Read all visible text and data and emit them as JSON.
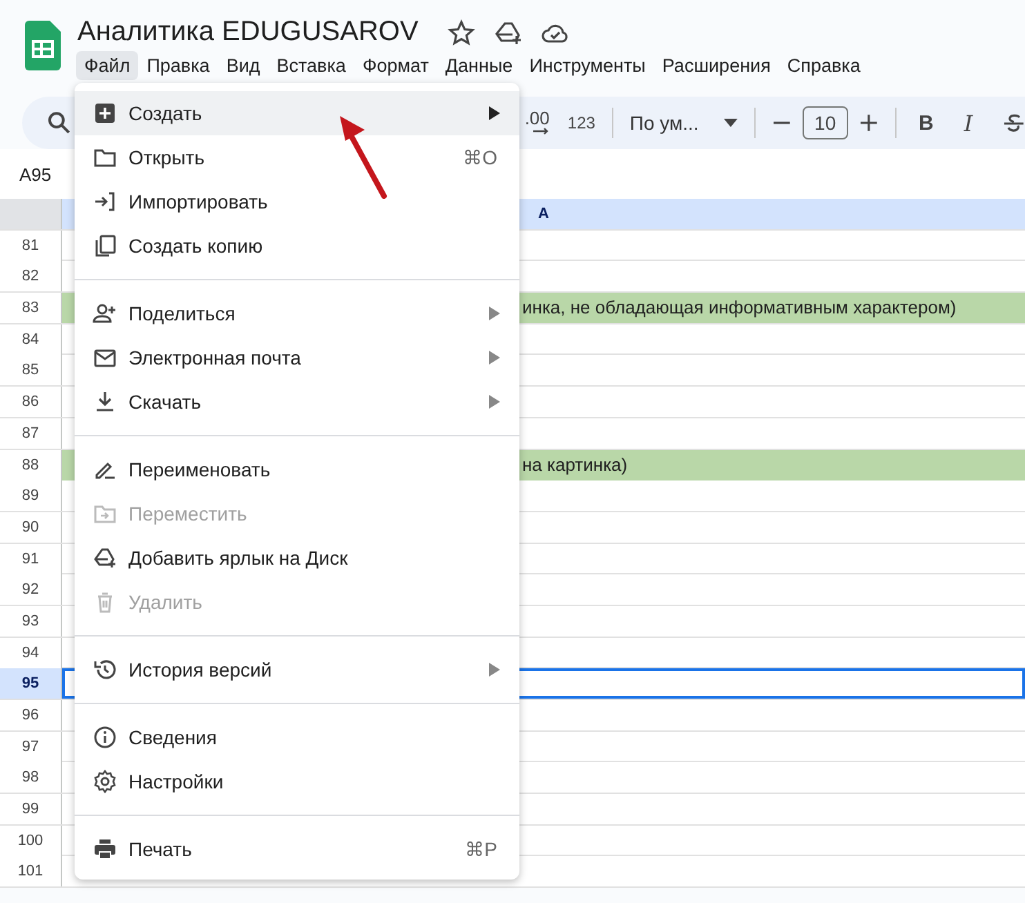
{
  "app": {
    "title": "Аналитика EDUGUSAROV",
    "menu": [
      {
        "label": "Файл",
        "selected": true
      },
      {
        "label": "Правка",
        "selected": false
      },
      {
        "label": "Вид",
        "selected": false
      },
      {
        "label": "Вставка",
        "selected": false
      },
      {
        "label": "Формат",
        "selected": false
      },
      {
        "label": "Данные",
        "selected": false
      },
      {
        "label": "Инструменты",
        "selected": false
      },
      {
        "label": "Расширения",
        "selected": false
      },
      {
        "label": "Справка",
        "selected": false
      }
    ]
  },
  "toolbar": {
    "decimal_label": ".00",
    "format_label": "123",
    "font": "По ум...",
    "font_size": "10",
    "bold_label": "B",
    "italic_label": "I"
  },
  "name_box": "A95",
  "sheet": {
    "column": "A",
    "rows": [
      {
        "number": "81",
        "selected": false,
        "highlighted": false
      },
      {
        "number": "82",
        "selected": false,
        "highlighted": false
      },
      {
        "number": "83",
        "right": "инка, не обладающая информативным характером)",
        "selected": false,
        "highlighted": true
      },
      {
        "number": "84",
        "selected": false,
        "highlighted": false
      },
      {
        "number": "85",
        "selected": false,
        "highlighted": false
      },
      {
        "number": "86",
        "selected": false,
        "highlighted": false
      },
      {
        "number": "87",
        "selected": false,
        "highlighted": false
      },
      {
        "number": "88",
        "right": "на картинка)",
        "selected": false,
        "highlighted": true
      },
      {
        "number": "89",
        "selected": false,
        "highlighted": false
      },
      {
        "number": "90",
        "selected": false,
        "highlighted": false
      },
      {
        "number": "91",
        "selected": false,
        "highlighted": false
      },
      {
        "number": "92",
        "selected": false,
        "highlighted": false
      },
      {
        "number": "93",
        "selected": false,
        "highlighted": false
      },
      {
        "number": "94",
        "selected": false,
        "highlighted": false
      },
      {
        "number": "95",
        "selected": true,
        "highlighted": false
      },
      {
        "number": "96",
        "selected": false,
        "highlighted": false
      },
      {
        "number": "97",
        "selected": false,
        "highlighted": false
      },
      {
        "number": "98",
        "selected": false,
        "highlighted": false
      },
      {
        "number": "99",
        "selected": false,
        "highlighted": false
      },
      {
        "number": "100",
        "selected": false,
        "highlighted": false
      },
      {
        "number": "101",
        "selected": false,
        "highlighted": false
      }
    ]
  },
  "file_menu": [
    {
      "kind": "item",
      "label": "Создать",
      "submenu": true,
      "disabled": false,
      "selected": true
    },
    {
      "kind": "item",
      "label": "Открыть",
      "shortcut": "⌘O",
      "submenu": false,
      "disabled": false,
      "selected": false
    },
    {
      "kind": "item",
      "label": "Импортировать",
      "submenu": false,
      "disabled": false,
      "selected": false
    },
    {
      "kind": "item",
      "label": "Создать копию",
      "submenu": false,
      "disabled": false,
      "selected": false
    },
    {
      "kind": "divider"
    },
    {
      "kind": "item",
      "label": "Поделиться",
      "submenu": true,
      "disabled": false,
      "selected": false
    },
    {
      "kind": "item",
      "label": "Электронная почта",
      "submenu": true,
      "disabled": false,
      "selected": false
    },
    {
      "kind": "item",
      "label": "Скачать",
      "submenu": true,
      "disabled": false,
      "selected": false
    },
    {
      "kind": "divider"
    },
    {
      "kind": "item",
      "label": "Переименовать",
      "submenu": false,
      "disabled": false,
      "selected": false
    },
    {
      "kind": "item",
      "label": "Переместить",
      "submenu": false,
      "disabled": true,
      "selected": false
    },
    {
      "kind": "item",
      "label": "Добавить ярлык на Диск",
      "submenu": false,
      "disabled": false,
      "selected": false
    },
    {
      "kind": "item",
      "label": "Удалить",
      "submenu": false,
      "disabled": true,
      "selected": false
    },
    {
      "kind": "divider"
    },
    {
      "kind": "item",
      "label": "История версий",
      "submenu": true,
      "disabled": false,
      "selected": false
    },
    {
      "kind": "divider"
    },
    {
      "kind": "item",
      "label": "Сведения",
      "submenu": false,
      "disabled": false,
      "selected": false
    },
    {
      "kind": "item",
      "label": "Настройки",
      "submenu": false,
      "disabled": false,
      "selected": false
    },
    {
      "kind": "divider"
    },
    {
      "kind": "item",
      "label": "Печать",
      "shortcut": "⌘P",
      "submenu": false,
      "disabled": false,
      "selected": false
    }
  ]
}
